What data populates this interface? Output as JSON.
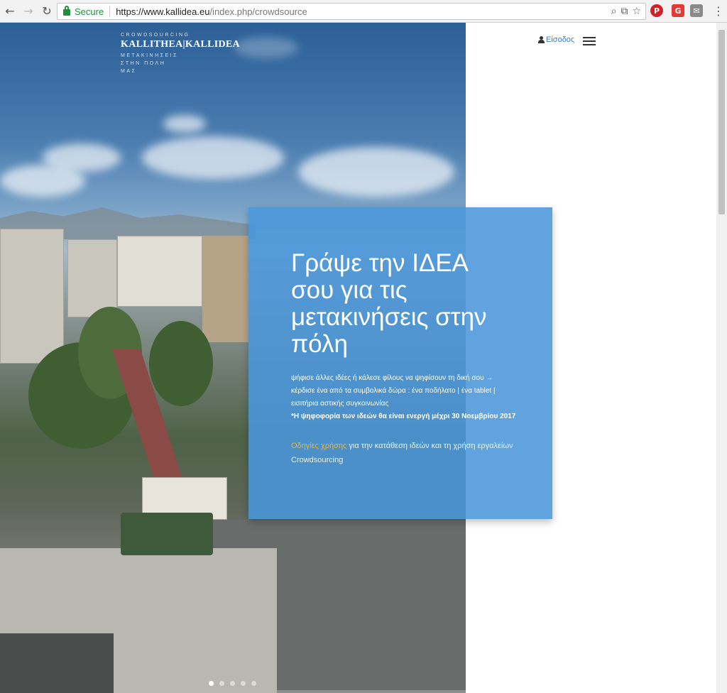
{
  "browser": {
    "secure_label": "Secure",
    "url_host": "https://www.kallidea.eu",
    "url_path": "/index.php/crowdsource"
  },
  "logo": {
    "top": "CROWDSOURCING",
    "main": "KALLITHEA|KALLIDEA",
    "sub": "ΜΕΤΑΚΙΝΗΣΕΙΣ ΣΤΗΝ ΠΟΛΗ ΜΑΣ"
  },
  "header": {
    "login_label": "Είσοδος"
  },
  "hero": {
    "title": "Γράψε την ΙΔΕΑ σου για τις μετακινήσεις στην πόλη",
    "line1": "ψήφισε άλλες ιδέες ή κάλεσε φίλους να ψηφίσουν τη δική σου →",
    "line2": "κέρδισε ένα από τα συμβολικά δώρα : ένα ποδήλατο | ένα tablet |",
    "line3": "εισιτήρια αστικής συγκοινωνίας",
    "note": "*Η ψηφοφορία των ιδεών θα είναι ενεργή μέχρι 30 Νοεμβρίου 2017",
    "guide_link": "Οδηγίες χρήσης",
    "guide_text": " για την κατάθεση ιδεών και τη χρήση εργαλείων Crowdsourcing"
  },
  "carousel": {
    "slides": 5,
    "active": 1
  },
  "colors": {
    "card": "#4a96db",
    "link_accent": "#f2b233",
    "login": "#3b7bbf"
  }
}
